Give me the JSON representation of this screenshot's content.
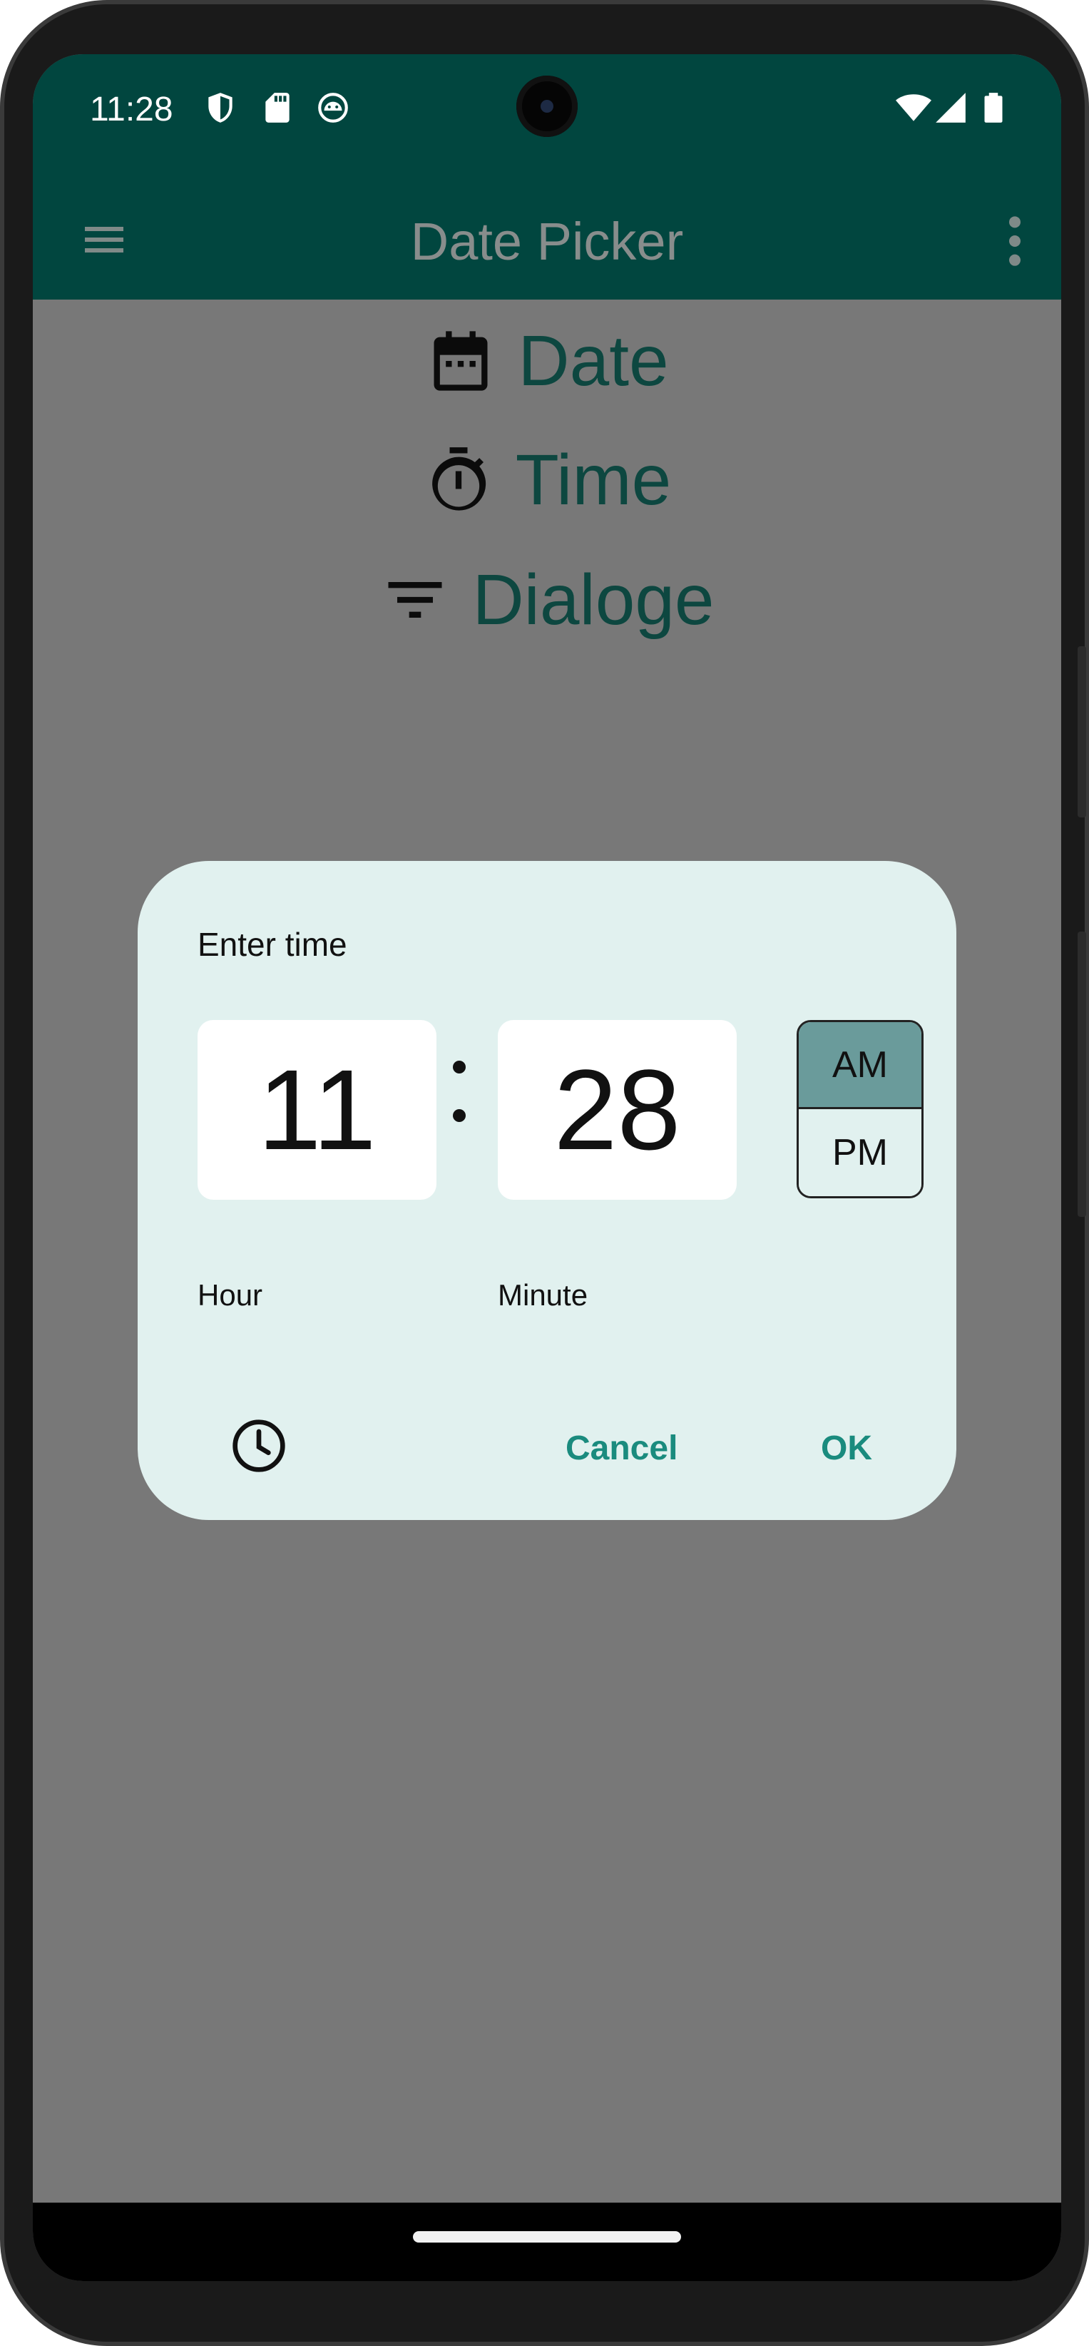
{
  "status_bar": {
    "time": "11:28",
    "icons": [
      "shield-icon",
      "sd-card-icon",
      "android-head-icon",
      "wifi-icon",
      "signal-icon",
      "battery-icon"
    ]
  },
  "app_bar": {
    "title": "Date Picker",
    "menu_icon": "hamburger-menu-icon",
    "overflow_icon": "more-vert-icon"
  },
  "main_items": [
    {
      "label": "Date",
      "icon": "calendar-icon"
    },
    {
      "label": "Time",
      "icon": "timer-icon"
    },
    {
      "label": "Dialoge",
      "icon": "filter-icon"
    }
  ],
  "dialog": {
    "title": "Enter time",
    "hour": "11",
    "minute": "28",
    "hour_label": "Hour",
    "minute_label": "Minute",
    "am_label": "AM",
    "pm_label": "PM",
    "selected_period": "AM",
    "cancel_label": "Cancel",
    "ok_label": "OK",
    "mode_toggle_icon": "clock-icon"
  },
  "colors": {
    "app_bar": "#01463f",
    "accent": "#1a8b7e",
    "dialog_bg": "#e1f1ef",
    "scrim": "#787878"
  }
}
